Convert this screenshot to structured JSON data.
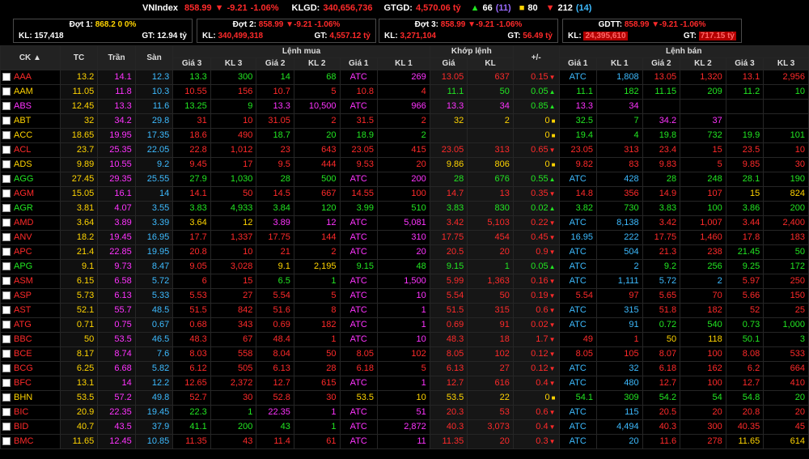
{
  "top": {
    "index_label": "VNIndex",
    "index_value": "858.99",
    "index_change": "-9.21",
    "index_pct": "-1.06%",
    "klgd_label": "KLGD:",
    "klgd_value": "340,656,736",
    "gtgd_label": "GTGD:",
    "gtgd_value": "4,570.06 tỷ",
    "up_count": "66",
    "up_ceiling": "(11)",
    "ref_count": "80",
    "down_count": "212",
    "down_floor": "(14)"
  },
  "sessions": [
    {
      "label": "Đợt 1:",
      "val": "868.2",
      "chg": "0",
      "pct": "0%",
      "kl_label": "KL:",
      "kl": "157,418",
      "gt_label": "GT:",
      "gt": "12.94 tỷ"
    },
    {
      "label": "Đợt 2:",
      "val": "858.99",
      "chg": "-9.21",
      "pct": "-1.06%",
      "kl_label": "KL:",
      "kl": "340,499,318",
      "gt_label": "GT:",
      "gt": "4,557.12 tỷ"
    },
    {
      "label": "Đợt 3:",
      "val": "858.99",
      "chg": "-9.21",
      "pct": "-1.06%",
      "kl_label": "KL:",
      "kl": "3,271,104",
      "gt_label": "GT:",
      "gt": "56.49 tỷ"
    },
    {
      "label": "GDTT:",
      "val": "858.99",
      "chg": "-9.21",
      "pct": "-1.06%",
      "kl_label": "KL:",
      "kl": "24,395,610",
      "gt_label": "GT:",
      "gt": "717.15 tỷ"
    }
  ],
  "headers": {
    "ck": "CK ▲",
    "tc": "TC",
    "tran": "Trần",
    "san": "Sàn",
    "lenh_mua": "Lệnh mua",
    "khop_lenh": "Khớp lệnh",
    "plusminus": "+/-",
    "lenh_ban": "Lệnh bán",
    "gia3": "Giá 3",
    "kl3": "KL 3",
    "gia2": "Giá 2",
    "kl2": "KL 2",
    "gia1": "Giá 1",
    "kl1": "KL 1",
    "gia": "Giá",
    "kl": "KL"
  },
  "colors": {
    "red": "#ff2a2a",
    "green": "#22e622",
    "yellow": "#ffd400",
    "pink": "#ff33ff",
    "cyan": "#3dbbff"
  },
  "rows": [
    {
      "s": "AAA",
      "sc": "r",
      "tc": "13.2",
      "tr": "14.1",
      "sa": "12.3",
      "b3": "13.3",
      "b3c": "g",
      "k3": "300",
      "b2": "14",
      "b2c": "g",
      "k2": "68",
      "b1": "ATC",
      "b1c": "p",
      "k1": "269",
      "m": "13.05",
      "mc": "r",
      "mk": "637",
      "ch": "0.15",
      "cd": "d",
      "s1": "ATC",
      "s1c": "c",
      "sk1": "1,808",
      "s2": "13.05",
      "s2c": "r",
      "sk2": "1,320",
      "s3": "13.1",
      "s3c": "r",
      "sk3": "2,956"
    },
    {
      "s": "AAM",
      "sc": "y",
      "tc": "11.05",
      "tr": "11.8",
      "sa": "10.3",
      "b3": "10.55",
      "b3c": "r",
      "k3": "156",
      "b2": "10.7",
      "b2c": "r",
      "k2": "5",
      "b1": "10.8",
      "b1c": "r",
      "k1": "4",
      "m": "11.1",
      "mc": "g",
      "mk": "50",
      "ch": "0.05",
      "cd": "u",
      "s1": "11.1",
      "s1c": "g",
      "sk1": "182",
      "s2": "11.15",
      "s2c": "g",
      "sk2": "209",
      "s3": "11.2",
      "s3c": "g",
      "sk3": "10"
    },
    {
      "s": "ABS",
      "sc": "p",
      "tc": "12.45",
      "tr": "13.3",
      "sa": "11.6",
      "b3": "13.25",
      "b3c": "g",
      "k3": "9",
      "b2": "13.3",
      "b2c": "p",
      "k2": "10,500",
      "b1": "ATC",
      "b1c": "p",
      "k1": "966",
      "m": "13.3",
      "mc": "p",
      "mk": "34",
      "ch": "0.85",
      "cd": "u",
      "s1": "13.3",
      "s1c": "p",
      "sk1": "34",
      "s2": "",
      "s2c": "w",
      "sk2": "",
      "s3": "",
      "s3c": "w",
      "sk3": ""
    },
    {
      "s": "ABT",
      "sc": "y",
      "tc": "32",
      "tr": "34.2",
      "sa": "29.8",
      "b3": "31",
      "b3c": "r",
      "k3": "10",
      "b2": "31.05",
      "b2c": "r",
      "k2": "2",
      "b1": "31.5",
      "b1c": "r",
      "k1": "2",
      "m": "32",
      "mc": "y",
      "mk": "2",
      "ch": "0",
      "cd": "s",
      "s1": "32.5",
      "s1c": "g",
      "sk1": "7",
      "s2": "34.2",
      "s2c": "p",
      "sk2": "37",
      "s3": "",
      "s3c": "w",
      "sk3": ""
    },
    {
      "s": "ACC",
      "sc": "y",
      "tc": "18.65",
      "tr": "19.95",
      "sa": "17.35",
      "b3": "18.6",
      "b3c": "r",
      "k3": "490",
      "b2": "18.7",
      "b2c": "g",
      "k2": "20",
      "b1": "18.9",
      "b1c": "g",
      "k1": "2",
      "m": "",
      "mc": "w",
      "mk": "",
      "ch": "0",
      "cd": "s",
      "s1": "19.4",
      "s1c": "g",
      "sk1": "4",
      "s2": "19.8",
      "s2c": "g",
      "sk2": "732",
      "s3": "19.9",
      "s3c": "g",
      "sk3": "101"
    },
    {
      "s": "ACL",
      "sc": "r",
      "tc": "23.7",
      "tr": "25.35",
      "sa": "22.05",
      "b3": "22.8",
      "b3c": "r",
      "k3": "1,012",
      "b2": "23",
      "b2c": "r",
      "k2": "643",
      "b1": "23.05",
      "b1c": "r",
      "k1": "415",
      "m": "23.05",
      "mc": "r",
      "mk": "313",
      "ch": "0.65",
      "cd": "d",
      "s1": "23.05",
      "s1c": "r",
      "sk1": "313",
      "s2": "23.4",
      "s2c": "r",
      "sk2": "15",
      "s3": "23.5",
      "s3c": "r",
      "sk3": "10"
    },
    {
      "s": "ADS",
      "sc": "y",
      "tc": "9.89",
      "tr": "10.55",
      "sa": "9.2",
      "b3": "9.45",
      "b3c": "r",
      "k3": "17",
      "b2": "9.5",
      "b2c": "r",
      "k2": "444",
      "b1": "9.53",
      "b1c": "r",
      "k1": "20",
      "m": "9.86",
      "mc": "y",
      "mk": "806",
      "ch": "0",
      "cd": "s",
      "s1": "9.82",
      "s1c": "r",
      "sk1": "83",
      "s2": "9.83",
      "s2c": "r",
      "sk2": "5",
      "s3": "9.85",
      "s3c": "r",
      "sk3": "30"
    },
    {
      "s": "AGG",
      "sc": "g",
      "tc": "27.45",
      "tr": "29.35",
      "sa": "25.55",
      "b3": "27.9",
      "b3c": "g",
      "k3": "1,030",
      "b2": "28",
      "b2c": "g",
      "k2": "500",
      "b1": "ATC",
      "b1c": "p",
      "k1": "200",
      "m": "28",
      "mc": "g",
      "mk": "676",
      "ch": "0.55",
      "cd": "u",
      "s1": "ATC",
      "s1c": "c",
      "sk1": "428",
      "s2": "28",
      "s2c": "g",
      "sk2": "248",
      "s3": "28.1",
      "s3c": "g",
      "sk3": "190"
    },
    {
      "s": "AGM",
      "sc": "r",
      "tc": "15.05",
      "tr": "16.1",
      "sa": "14",
      "b3": "14.1",
      "b3c": "r",
      "k3": "50",
      "b2": "14.5",
      "b2c": "r",
      "k2": "667",
      "b1": "14.55",
      "b1c": "r",
      "k1": "100",
      "m": "14.7",
      "mc": "r",
      "mk": "13",
      "ch": "0.35",
      "cd": "d",
      "s1": "14.8",
      "s1c": "r",
      "sk1": "356",
      "s2": "14.9",
      "s2c": "r",
      "sk2": "107",
      "s3": "15",
      "s3c": "y",
      "sk3": "824"
    },
    {
      "s": "AGR",
      "sc": "g",
      "tc": "3.81",
      "tr": "4.07",
      "sa": "3.55",
      "b3": "3.83",
      "b3c": "g",
      "k3": "4,933",
      "b2": "3.84",
      "b2c": "g",
      "k2": "120",
      "b1": "3.99",
      "b1c": "g",
      "k1": "510",
      "m": "3.83",
      "mc": "g",
      "mk": "830",
      "ch": "0.02",
      "cd": "u",
      "s1": "3.82",
      "s1c": "g",
      "sk1": "730",
      "s2": "3.83",
      "s2c": "g",
      "sk2": "100",
      "s3": "3.86",
      "s3c": "g",
      "sk3": "200"
    },
    {
      "s": "AMD",
      "sc": "r",
      "tc": "3.64",
      "tr": "3.89",
      "sa": "3.39",
      "b3": "3.64",
      "b3c": "y",
      "k3": "12",
      "b2": "3.89",
      "b2c": "p",
      "k2": "12",
      "b1": "ATC",
      "b1c": "p",
      "k1": "5,081",
      "m": "3.42",
      "mc": "r",
      "mk": "5,103",
      "ch": "0.22",
      "cd": "d",
      "s1": "ATC",
      "s1c": "c",
      "sk1": "8,138",
      "s2": "3.42",
      "s2c": "r",
      "sk2": "1,007",
      "s3": "3.44",
      "s3c": "r",
      "sk3": "2,400"
    },
    {
      "s": "ANV",
      "sc": "r",
      "tc": "18.2",
      "tr": "19.45",
      "sa": "16.95",
      "b3": "17.7",
      "b3c": "r",
      "k3": "1,337",
      "b2": "17.75",
      "b2c": "r",
      "k2": "144",
      "b1": "ATC",
      "b1c": "p",
      "k1": "310",
      "m": "17.75",
      "mc": "r",
      "mk": "454",
      "ch": "0.45",
      "cd": "d",
      "s1": "16.95",
      "s1c": "c",
      "sk1": "222",
      "s2": "17.75",
      "s2c": "r",
      "sk2": "1,460",
      "s3": "17.8",
      "s3c": "r",
      "sk3": "183"
    },
    {
      "s": "APC",
      "sc": "r",
      "tc": "21.4",
      "tr": "22.85",
      "sa": "19.95",
      "b3": "20.8",
      "b3c": "r",
      "k3": "10",
      "b2": "21",
      "b2c": "r",
      "k2": "2",
      "b1": "ATC",
      "b1c": "p",
      "k1": "20",
      "m": "20.5",
      "mc": "r",
      "mk": "20",
      "ch": "0.9",
      "cd": "d",
      "s1": "ATC",
      "s1c": "c",
      "sk1": "504",
      "s2": "21.3",
      "s2c": "r",
      "sk2": "238",
      "s3": "21.45",
      "s3c": "g",
      "sk3": "50"
    },
    {
      "s": "APG",
      "sc": "g",
      "tc": "9.1",
      "tr": "9.73",
      "sa": "8.47",
      "b3": "9.05",
      "b3c": "r",
      "k3": "3,028",
      "b2": "9.1",
      "b2c": "y",
      "k2": "2,195",
      "b1": "9.15",
      "b1c": "g",
      "k1": "48",
      "m": "9.15",
      "mc": "g",
      "mk": "1",
      "ch": "0.05",
      "cd": "u",
      "s1": "ATC",
      "s1c": "c",
      "sk1": "2",
      "s2": "9.2",
      "s2c": "g",
      "sk2": "256",
      "s3": "9.25",
      "s3c": "g",
      "sk3": "172"
    },
    {
      "s": "ASM",
      "sc": "r",
      "tc": "6.15",
      "tr": "6.58",
      "sa": "5.72",
      "b3": "6",
      "b3c": "r",
      "k3": "15",
      "b2": "6.5",
      "b2c": "g",
      "k2": "1",
      "b1": "ATC",
      "b1c": "p",
      "k1": "1,500",
      "m": "5.99",
      "mc": "r",
      "mk": "1,363",
      "ch": "0.16",
      "cd": "d",
      "s1": "ATC",
      "s1c": "c",
      "sk1": "1,111",
      "s2": "5.72",
      "s2c": "c",
      "sk2": "2",
      "s3": "5.97",
      "s3c": "r",
      "sk3": "250"
    },
    {
      "s": "ASP",
      "sc": "r",
      "tc": "5.73",
      "tr": "6.13",
      "sa": "5.33",
      "b3": "5.53",
      "b3c": "r",
      "k3": "27",
      "b2": "5.54",
      "b2c": "r",
      "k2": "5",
      "b1": "ATC",
      "b1c": "p",
      "k1": "10",
      "m": "5.54",
      "mc": "r",
      "mk": "50",
      "ch": "0.19",
      "cd": "d",
      "s1": "5.54",
      "s1c": "r",
      "sk1": "97",
      "s2": "5.65",
      "s2c": "r",
      "sk2": "70",
      "s3": "5.66",
      "s3c": "r",
      "sk3": "150"
    },
    {
      "s": "AST",
      "sc": "r",
      "tc": "52.1",
      "tr": "55.7",
      "sa": "48.5",
      "b3": "51.5",
      "b3c": "r",
      "k3": "842",
      "b2": "51.6",
      "b2c": "r",
      "k2": "8",
      "b1": "ATC",
      "b1c": "p",
      "k1": "1",
      "m": "51.5",
      "mc": "r",
      "mk": "315",
      "ch": "0.6",
      "cd": "d",
      "s1": "ATC",
      "s1c": "c",
      "sk1": "315",
      "s2": "51.8",
      "s2c": "r",
      "sk2": "182",
      "s3": "52",
      "s3c": "r",
      "sk3": "25"
    },
    {
      "s": "ATG",
      "sc": "r",
      "tc": "0.71",
      "tr": "0.75",
      "sa": "0.67",
      "b3": "0.68",
      "b3c": "r",
      "k3": "343",
      "b2": "0.69",
      "b2c": "r",
      "k2": "182",
      "b1": "ATC",
      "b1c": "p",
      "k1": "1",
      "m": "0.69",
      "mc": "r",
      "mk": "91",
      "ch": "0.02",
      "cd": "d",
      "s1": "ATC",
      "s1c": "c",
      "sk1": "91",
      "s2": "0.72",
      "s2c": "g",
      "sk2": "540",
      "s3": "0.73",
      "s3c": "g",
      "sk3": "1,000"
    },
    {
      "s": "BBC",
      "sc": "r",
      "tc": "50",
      "tr": "53.5",
      "sa": "46.5",
      "b3": "48.3",
      "b3c": "r",
      "k3": "67",
      "b2": "48.4",
      "b2c": "r",
      "k2": "1",
      "b1": "ATC",
      "b1c": "p",
      "k1": "10",
      "m": "48.3",
      "mc": "r",
      "mk": "18",
      "ch": "1.7",
      "cd": "d",
      "s1": "49",
      "s1c": "r",
      "sk1": "1",
      "s2": "50",
      "s2c": "y",
      "sk2": "118",
      "s3": "50.1",
      "s3c": "g",
      "sk3": "3"
    },
    {
      "s": "BCE",
      "sc": "r",
      "tc": "8.17",
      "tr": "8.74",
      "sa": "7.6",
      "b3": "8.03",
      "b3c": "r",
      "k3": "558",
      "b2": "8.04",
      "b2c": "r",
      "k2": "50",
      "b1": "8.05",
      "b1c": "r",
      "k1": "102",
      "m": "8.05",
      "mc": "r",
      "mk": "102",
      "ch": "0.12",
      "cd": "d",
      "s1": "8.05",
      "s1c": "r",
      "sk1": "105",
      "s2": "8.07",
      "s2c": "r",
      "sk2": "100",
      "s3": "8.08",
      "s3c": "r",
      "sk3": "533"
    },
    {
      "s": "BCG",
      "sc": "r",
      "tc": "6.25",
      "tr": "6.68",
      "sa": "5.82",
      "b3": "6.12",
      "b3c": "r",
      "k3": "505",
      "b2": "6.13",
      "b2c": "r",
      "k2": "28",
      "b1": "6.18",
      "b1c": "r",
      "k1": "5",
      "m": "6.13",
      "mc": "r",
      "mk": "27",
      "ch": "0.12",
      "cd": "d",
      "s1": "ATC",
      "s1c": "c",
      "sk1": "32",
      "s2": "6.18",
      "s2c": "r",
      "sk2": "162",
      "s3": "6.2",
      "s3c": "r",
      "sk3": "664"
    },
    {
      "s": "BFC",
      "sc": "r",
      "tc": "13.1",
      "tr": "14",
      "sa": "12.2",
      "b3": "12.65",
      "b3c": "r",
      "k3": "2,372",
      "b2": "12.7",
      "b2c": "r",
      "k2": "615",
      "b1": "ATC",
      "b1c": "p",
      "k1": "1",
      "m": "12.7",
      "mc": "r",
      "mk": "616",
      "ch": "0.4",
      "cd": "d",
      "s1": "ATC",
      "s1c": "c",
      "sk1": "480",
      "s2": "12.7",
      "s2c": "r",
      "sk2": "100",
      "s3": "12.7",
      "s3c": "r",
      "sk3": "410"
    },
    {
      "s": "BHN",
      "sc": "y",
      "tc": "53.5",
      "tr": "57.2",
      "sa": "49.8",
      "b3": "52.7",
      "b3c": "r",
      "k3": "30",
      "b2": "52.8",
      "b2c": "r",
      "k2": "30",
      "b1": "53.5",
      "b1c": "y",
      "k1": "10",
      "m": "53.5",
      "mc": "y",
      "mk": "22",
      "ch": "0",
      "cd": "s",
      "s1": "54.1",
      "s1c": "g",
      "sk1": "309",
      "s2": "54.2",
      "s2c": "g",
      "sk2": "54",
      "s3": "54.8",
      "s3c": "g",
      "sk3": "20"
    },
    {
      "s": "BIC",
      "sc": "r",
      "tc": "20.9",
      "tr": "22.35",
      "sa": "19.45",
      "b3": "22.3",
      "b3c": "g",
      "k3": "1",
      "b2": "22.35",
      "b2c": "p",
      "k2": "1",
      "b1": "ATC",
      "b1c": "p",
      "k1": "51",
      "m": "20.3",
      "mc": "r",
      "mk": "53",
      "ch": "0.6",
      "cd": "d",
      "s1": "ATC",
      "s1c": "c",
      "sk1": "115",
      "s2": "20.5",
      "s2c": "r",
      "sk2": "20",
      "s3": "20.8",
      "s3c": "r",
      "sk3": "20"
    },
    {
      "s": "BID",
      "sc": "r",
      "tc": "40.7",
      "tr": "43.5",
      "sa": "37.9",
      "b3": "41.1",
      "b3c": "g",
      "k3": "200",
      "b2": "43",
      "b2c": "g",
      "k2": "1",
      "b1": "ATC",
      "b1c": "p",
      "k1": "2,872",
      "m": "40.3",
      "mc": "r",
      "mk": "3,073",
      "ch": "0.4",
      "cd": "d",
      "s1": "ATC",
      "s1c": "c",
      "sk1": "4,494",
      "s2": "40.3",
      "s2c": "r",
      "sk2": "300",
      "s3": "40.35",
      "s3c": "r",
      "sk3": "45"
    },
    {
      "s": "BMC",
      "sc": "r",
      "tc": "11.65",
      "tr": "12.45",
      "sa": "10.85",
      "b3": "11.35",
      "b3c": "r",
      "k3": "43",
      "b2": "11.4",
      "b2c": "r",
      "k2": "61",
      "b1": "ATC",
      "b1c": "p",
      "k1": "11",
      "m": "11.35",
      "mc": "r",
      "mk": "20",
      "ch": "0.3",
      "cd": "d",
      "s1": "ATC",
      "s1c": "c",
      "sk1": "20",
      "s2": "11.6",
      "s2c": "r",
      "sk2": "278",
      "s3": "11.65",
      "s3c": "y",
      "sk3": "614"
    }
  ]
}
